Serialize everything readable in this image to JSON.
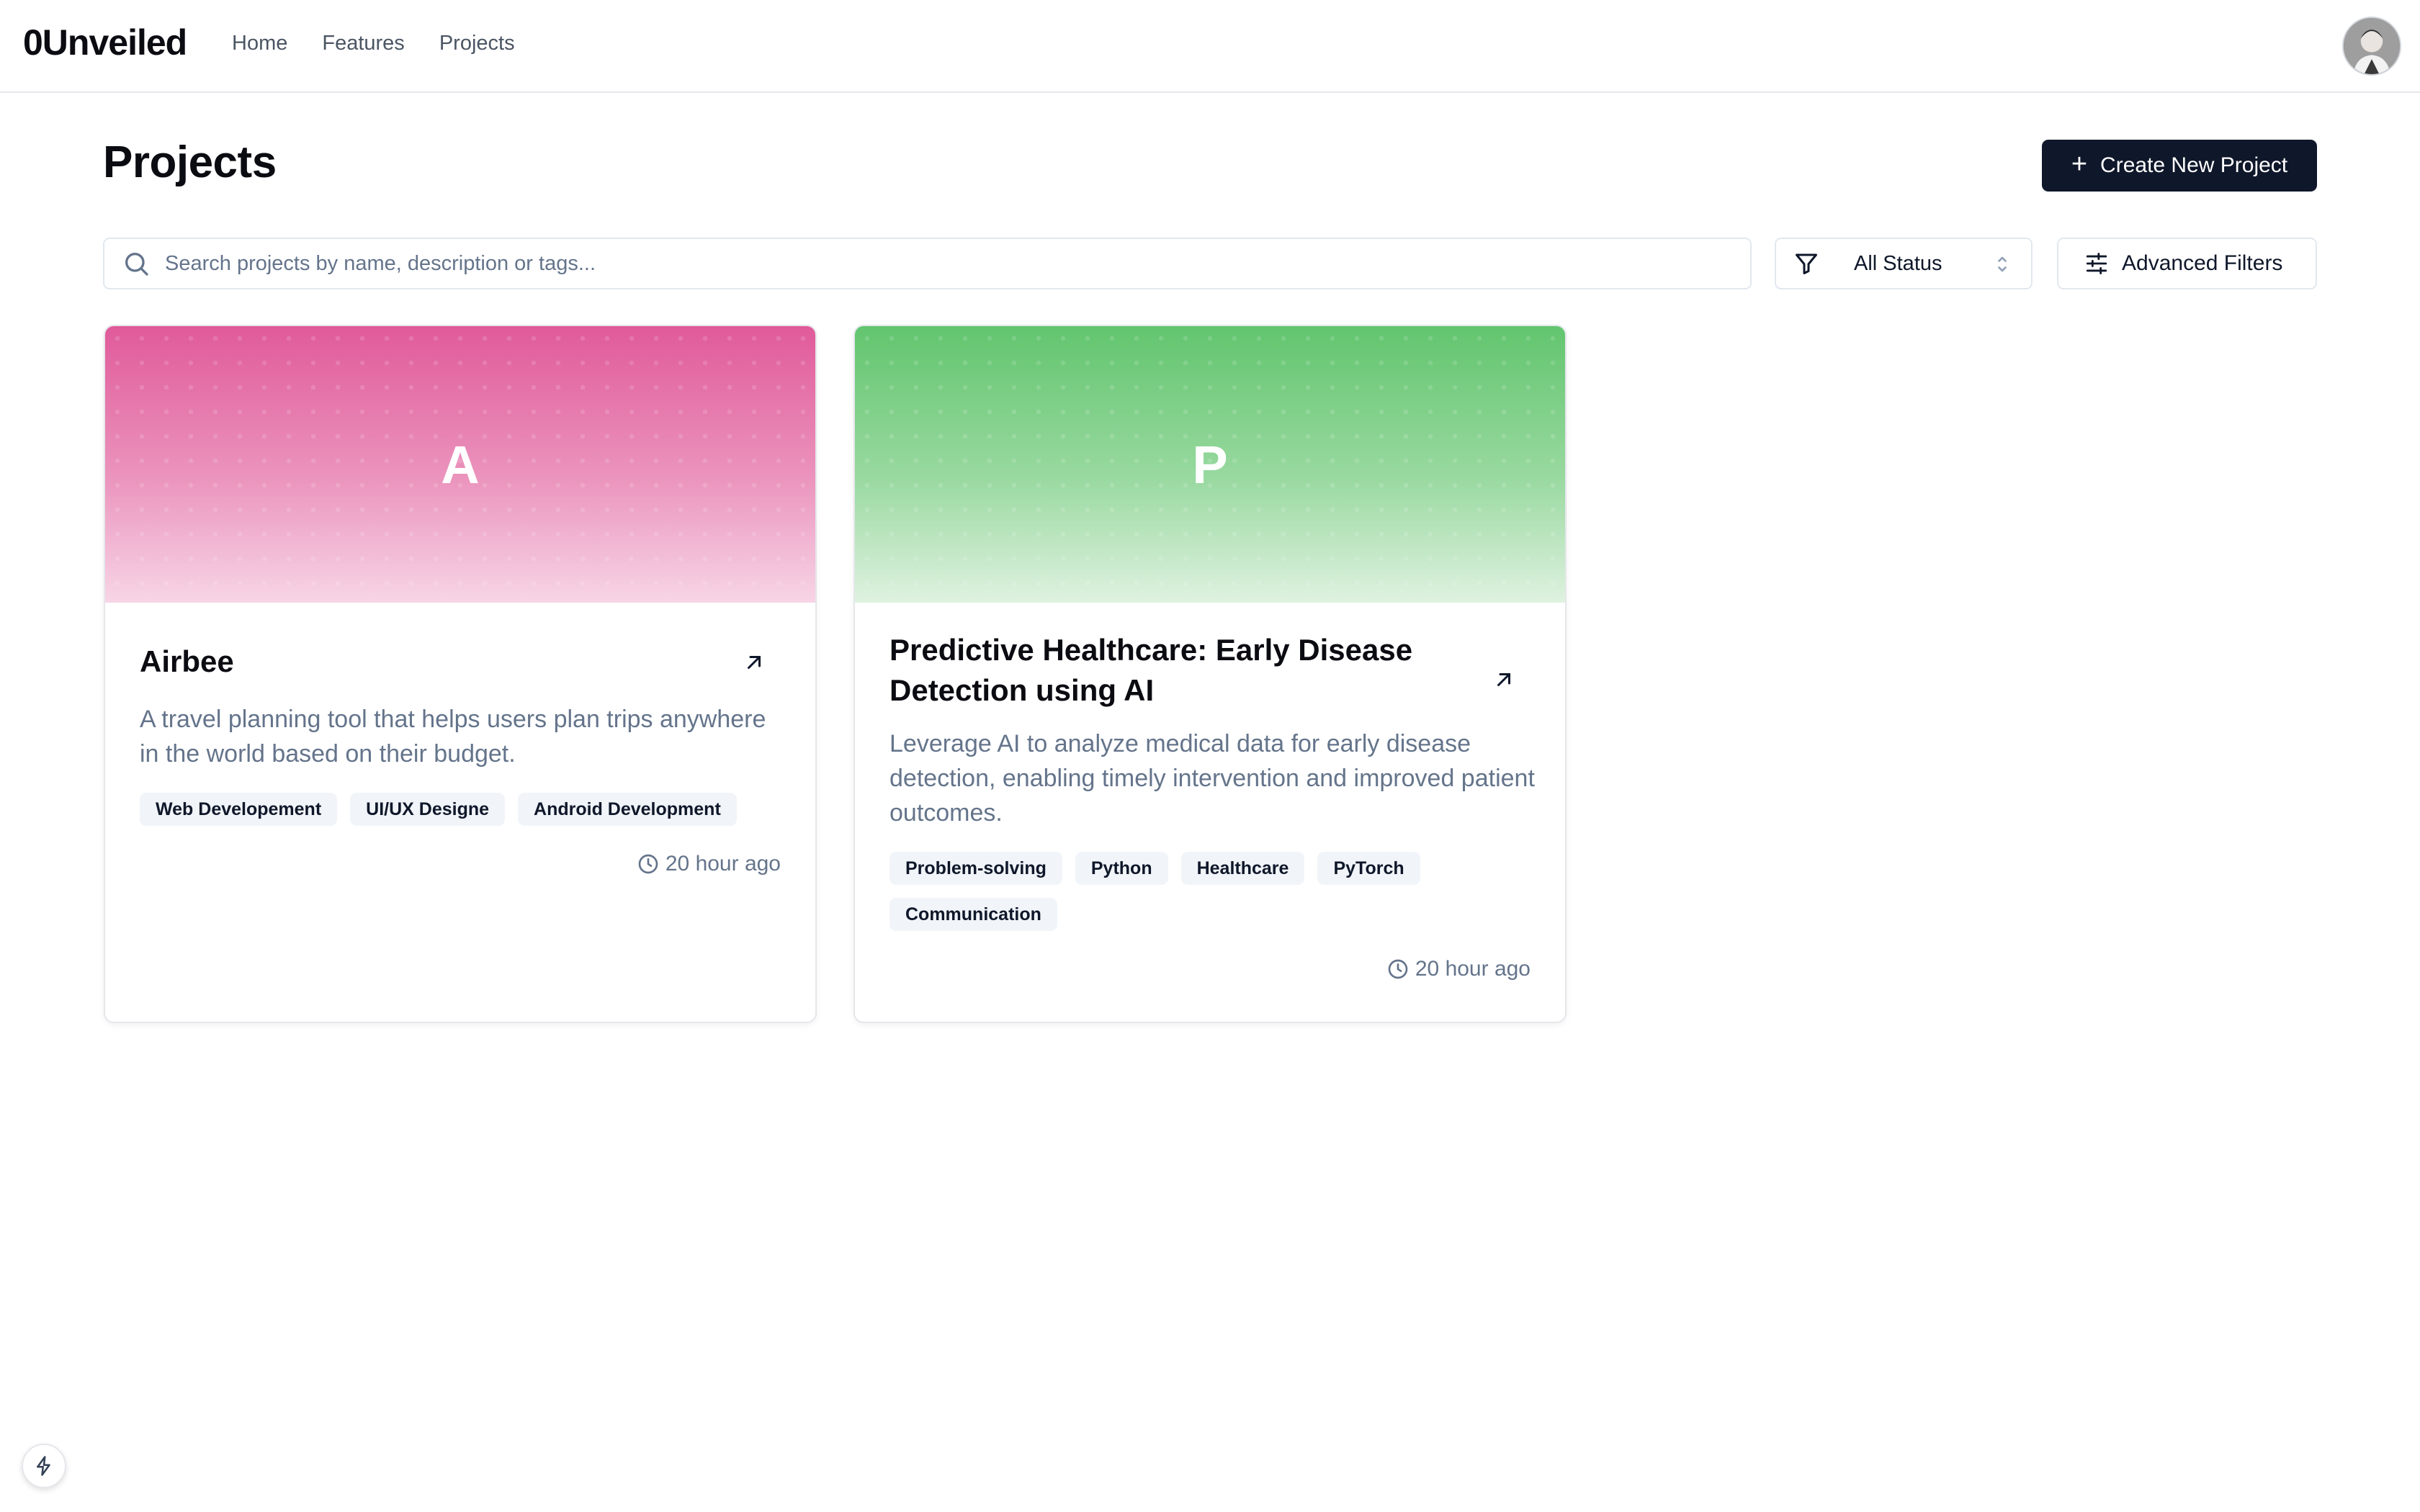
{
  "header": {
    "logo": "0Unveiled",
    "nav": [
      "Home",
      "Features",
      "Projects"
    ]
  },
  "page": {
    "title": "Projects",
    "create_button": "Create New Project"
  },
  "filters": {
    "search_placeholder": "Search projects by name, description or tags...",
    "status_value": "All Status",
    "advanced_label": "Advanced Filters"
  },
  "projects": [
    {
      "letter": "A",
      "cover_color": "#e05a9a",
      "title": "Airbee",
      "description": "A travel planning tool that helps users plan trips anywhere in the world based on their budget.",
      "tags": [
        "Web Developement",
        "UI/UX Designe",
        "Android Development"
      ],
      "time": "20 hour ago"
    },
    {
      "letter": "P",
      "cover_color": "#62c56e",
      "title": "Predictive Healthcare: Early Disease Detection using AI",
      "description": "Leverage AI to analyze medical data for early disease detection, enabling timely intervention and improved patient outcomes.",
      "tags": [
        "Problem-solving",
        "Python",
        "Healthcare",
        "PyTorch",
        "Communication"
      ],
      "time": "20 hour ago"
    }
  ],
  "colors": {
    "primary_button": "#0f172a",
    "muted_text": "#64748b",
    "tag_bg": "#f1f5f9"
  }
}
